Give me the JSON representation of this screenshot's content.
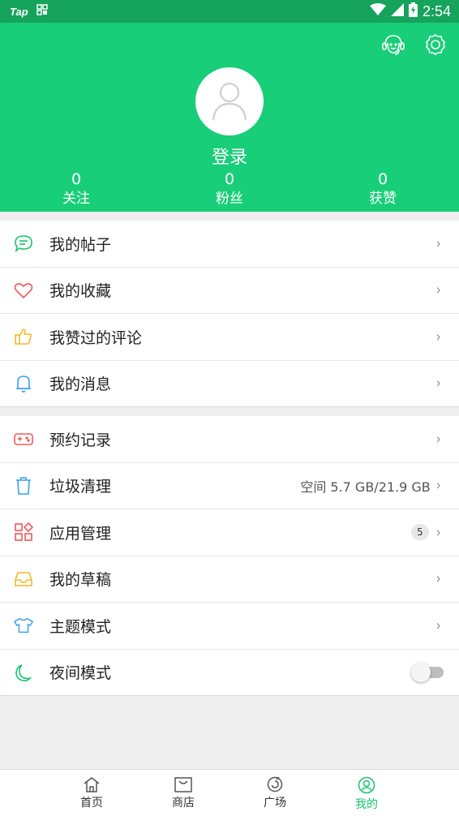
{
  "status_bar": {
    "left_labels": [
      "Tap",
      "墨"
    ],
    "time": "2:54"
  },
  "header": {
    "login_label": "登录",
    "stats": [
      {
        "value": "0",
        "label": "关注"
      },
      {
        "value": "0",
        "label": "粉丝"
      },
      {
        "value": "0",
        "label": "获赞"
      }
    ],
    "icons": [
      "customer-service-icon",
      "settings-icon"
    ],
    "color": "#18ce78"
  },
  "group1": [
    {
      "label": "我的帖子",
      "icon": "message-icon",
      "color": "#18c46f"
    },
    {
      "label": "我的收藏",
      "icon": "heart-icon",
      "color": "#f05a5a"
    },
    {
      "label": "我赞过的评论",
      "icon": "thumbs-up-icon",
      "color": "#f5b92b"
    },
    {
      "label": "我的消息",
      "icon": "bell-icon",
      "color": "#3a9ff0"
    }
  ],
  "group2": [
    {
      "label": "预约记录",
      "icon": "gamepad-icon",
      "color": "#f05a5a"
    },
    {
      "label": "垃圾清理",
      "icon": "trash-icon",
      "color": "#3a9ff0",
      "detail": "空间 5.7 GB/21.9 GB"
    },
    {
      "label": "应用管理",
      "icon": "apps-icon",
      "color": "#f05a5a",
      "badge": "5"
    },
    {
      "label": "我的草稿",
      "icon": "inbox-icon",
      "color": "#f5b92b"
    },
    {
      "label": "主题模式",
      "icon": "tshirt-icon",
      "color": "#3a9ff0"
    },
    {
      "label": "夜间模式",
      "icon": "moon-icon",
      "color": "#18c46f",
      "toggle": false
    }
  ],
  "bottom_nav": [
    {
      "label": "首页",
      "icon": "home-icon"
    },
    {
      "label": "商店",
      "icon": "store-icon"
    },
    {
      "label": "广场",
      "icon": "plaza-icon"
    },
    {
      "label": "我的",
      "icon": "profile-icon",
      "active": true
    }
  ]
}
